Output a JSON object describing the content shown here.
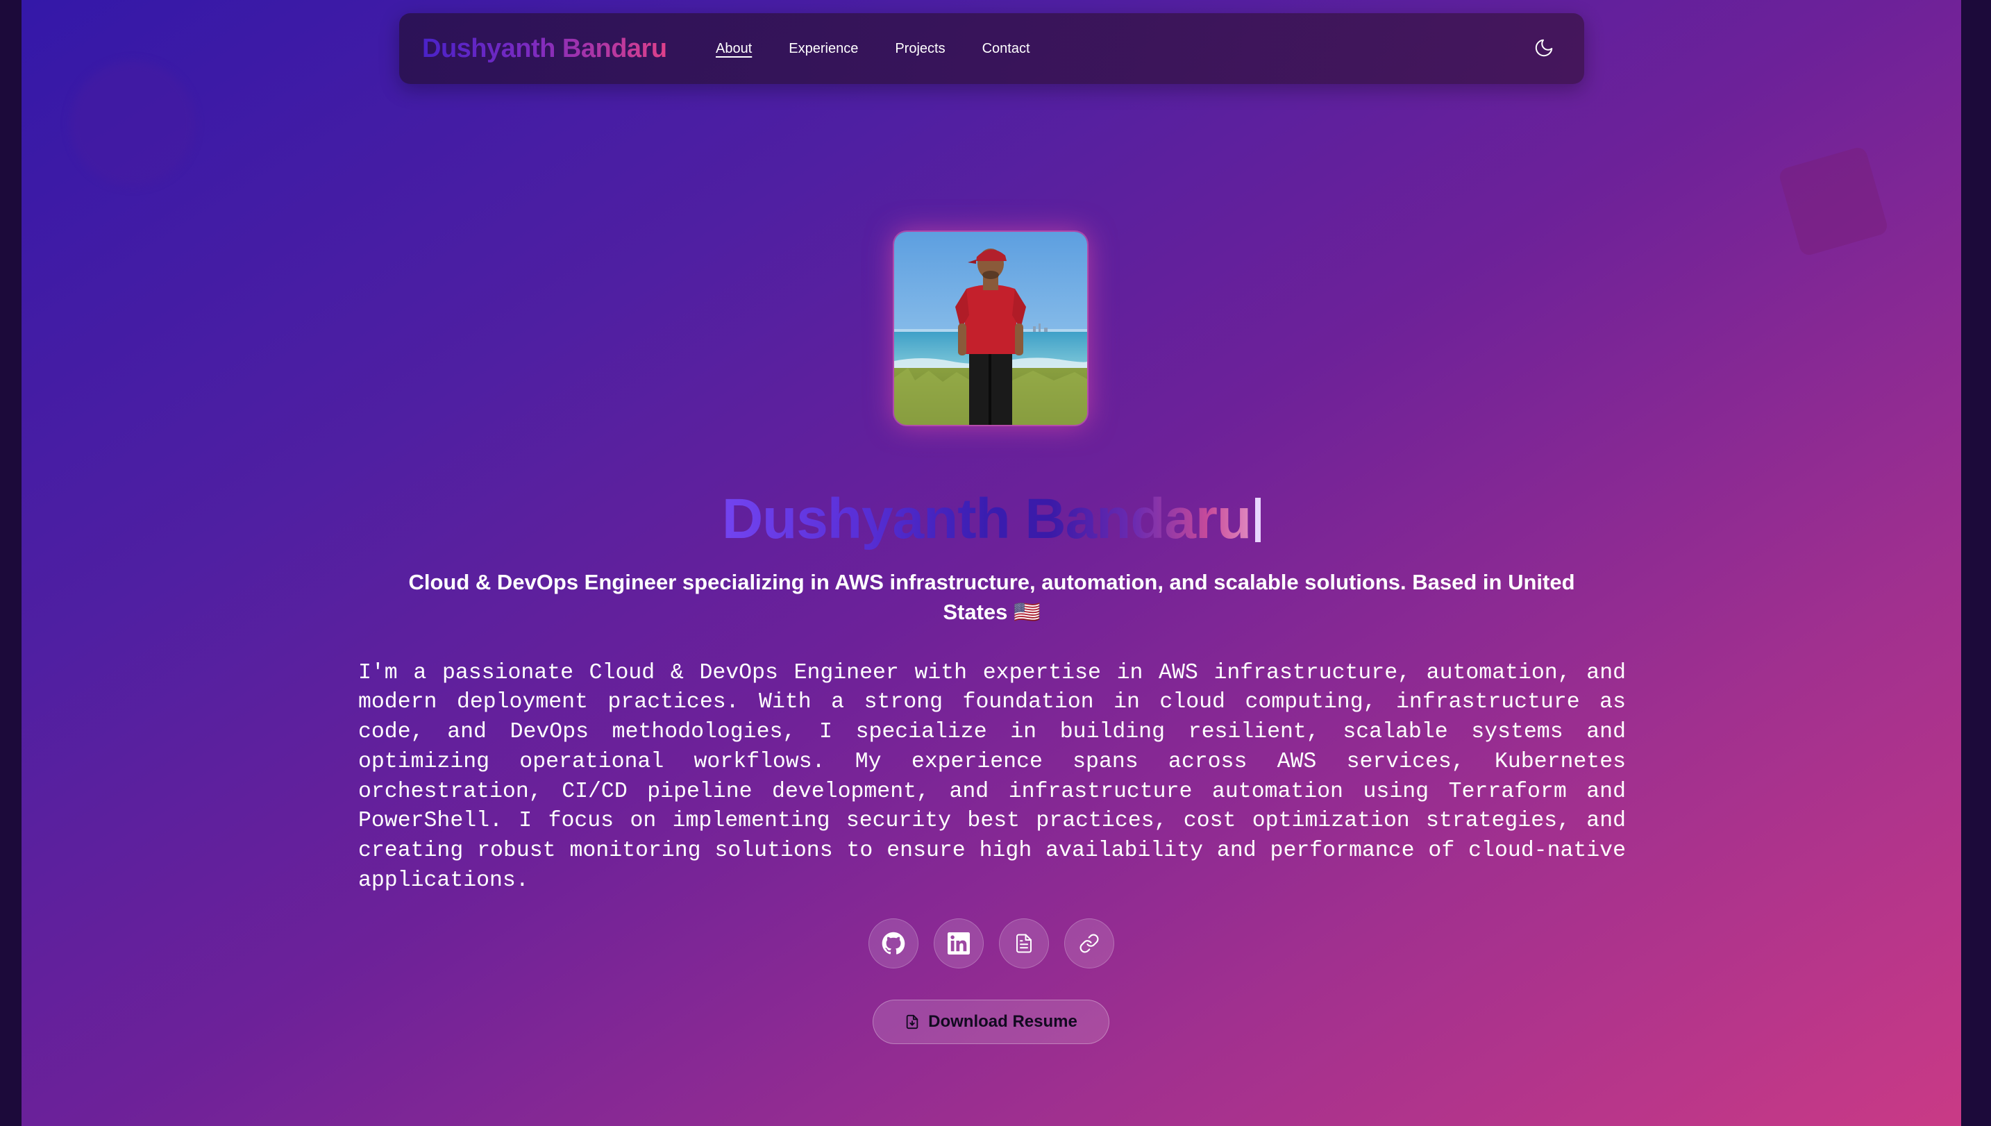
{
  "nav": {
    "brand": "Dushyanth Bandaru",
    "links": [
      {
        "label": "About",
        "active": true
      },
      {
        "label": "Experience",
        "active": false
      },
      {
        "label": "Projects",
        "active": false
      },
      {
        "label": "Contact",
        "active": false
      }
    ],
    "theme_toggle_icon": "moon-icon"
  },
  "hero": {
    "avatar_alt": "Profile photo",
    "name": "Dushyanth Bandaru",
    "tagline": "Cloud & DevOps Engineer specializing in AWS infrastructure, automation, and scalable solutions. Based in United States 🇺🇸",
    "bio": "I'm a passionate Cloud & DevOps Engineer with expertise in AWS infrastructure, automation, and modern deployment practices. With a strong foundation in cloud computing, infrastructure as code, and DevOps methodologies, I specialize in building resilient, scalable systems and optimizing operational workflows. My experience spans across AWS services, Kubernetes orchestration, CI/CD pipeline development, and infrastructure automation using Terraform and PowerShell. I focus on implementing security best practices, cost optimization strategies, and creating robust monitoring solutions to ensure high availability and performance of cloud-native applications."
  },
  "socials": [
    {
      "icon": "github-icon"
    },
    {
      "icon": "linkedin-icon"
    },
    {
      "icon": "document-icon"
    },
    {
      "icon": "link-icon"
    }
  ],
  "resume_button": {
    "label": "Download Resume",
    "icon": "file-download-icon"
  },
  "colors": {
    "gradient_start": "#3418a8",
    "gradient_end": "#c93a86",
    "brand_start": "#4a22c8",
    "brand_end": "#e0418a"
  }
}
